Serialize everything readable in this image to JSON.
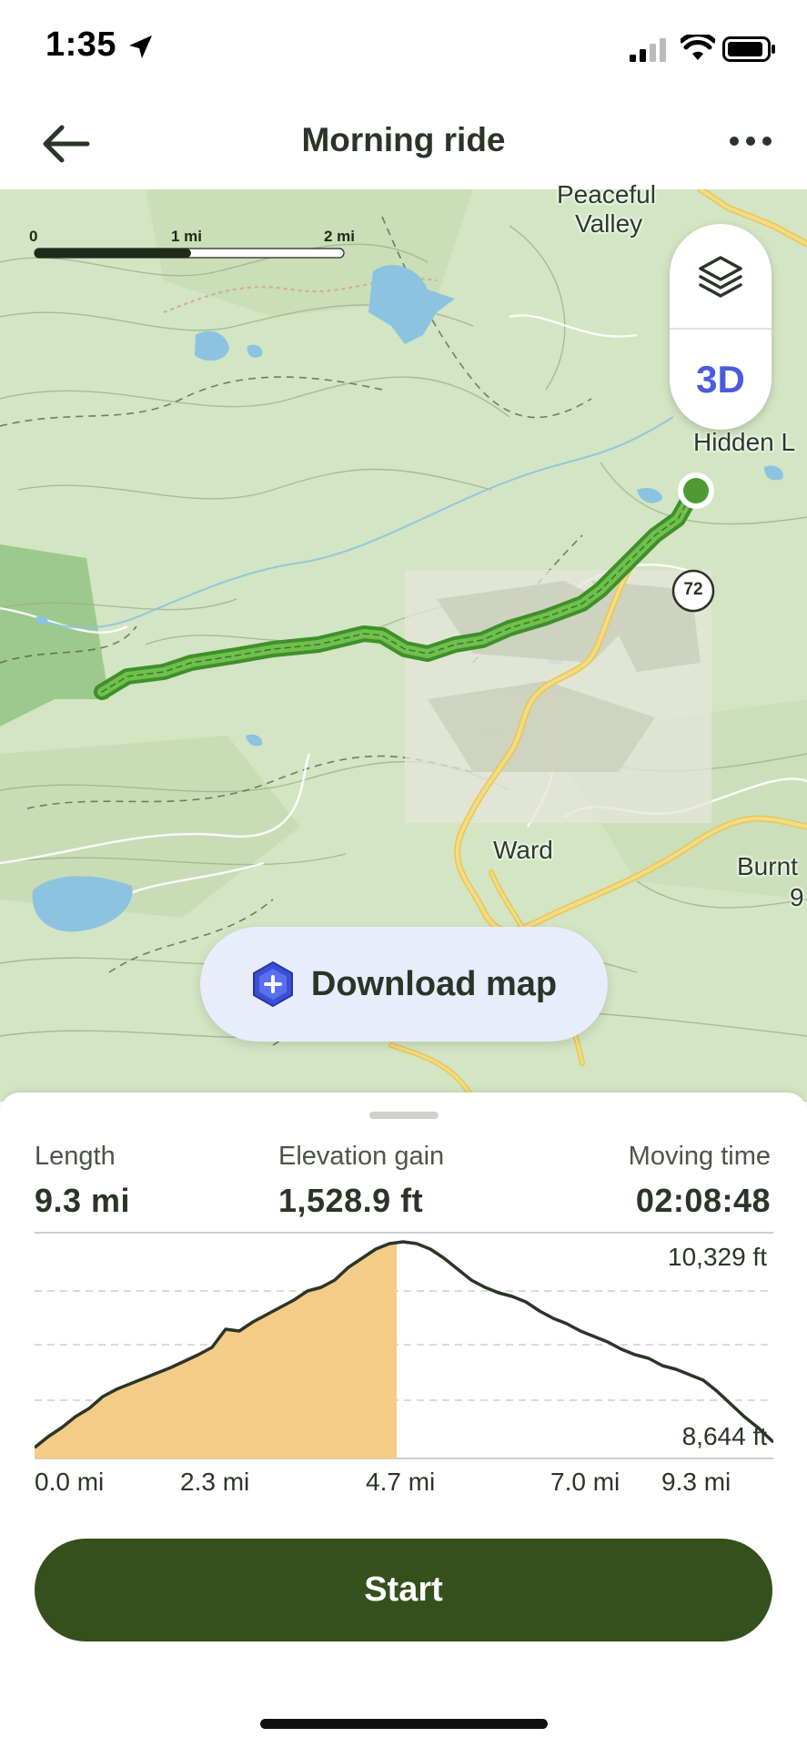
{
  "status_bar": {
    "time": "1:35",
    "icons": [
      "location-arrow-icon",
      "signal-icon",
      "wifi-icon",
      "battery-icon"
    ]
  },
  "header": {
    "title": "Morning ride",
    "back_icon": "back-arrow-icon",
    "more_icon": "more-icon"
  },
  "map": {
    "scale": {
      "labels": [
        "0",
        "1 mi",
        "2 mi"
      ]
    },
    "place_labels": [
      "Peaceful",
      "Valley",
      "Hidden L",
      "Ward",
      "Burnt",
      "9"
    ],
    "road_shield": "72",
    "layer_controls": {
      "layers_icon": "layers-icon",
      "three_d_label": "3D"
    },
    "download_button": {
      "label": "Download map",
      "icon": "download-map-icon"
    },
    "colors": {
      "route": "#5bb03a",
      "trail_marker": "#4a9b2e",
      "road": "#f0d46a",
      "water": "#8cc3e0"
    }
  },
  "stats": {
    "length": {
      "label": "Length",
      "value": "9.3 mi"
    },
    "elevation_gain": {
      "label": "Elevation gain",
      "value": "1,528.9 ft"
    },
    "moving_time": {
      "label": "Moving time",
      "value": "02:08:48"
    }
  },
  "elevation_profile": {
    "max_label": "10,329 ft",
    "min_label": "8,644 ft",
    "distance_labels": [
      "0.0 mi",
      "2.3 mi",
      "4.7 mi",
      "7.0 mi",
      "9.3 mi"
    ],
    "highlight_color": "#f5cc85",
    "line_color": "#2b3527",
    "progress_fraction": 0.49
  },
  "actions": {
    "start_label": "Start"
  }
}
